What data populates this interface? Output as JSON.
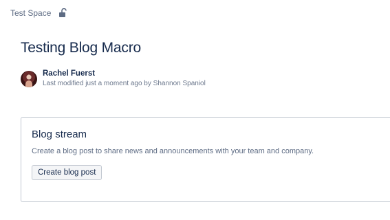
{
  "breadcrumb": {
    "space_name": "Test Space",
    "lock_icon": "unlocked-padlock-icon"
  },
  "page": {
    "title": "Testing Blog Macro"
  },
  "byline": {
    "author": "Rachel Fuerst",
    "modified_prefix": "Last modified just a moment ago by",
    "modified_by": "Shannon Spaniol"
  },
  "blog_stream": {
    "title": "Blog stream",
    "description": "Create a blog post to share news and announcements with your team and company.",
    "button_label": "Create blog post"
  },
  "colors": {
    "text_primary": "#172b4d",
    "text_secondary": "#5e6c84",
    "border": "#c1c7d0",
    "button_bg": "#f4f5f7"
  }
}
